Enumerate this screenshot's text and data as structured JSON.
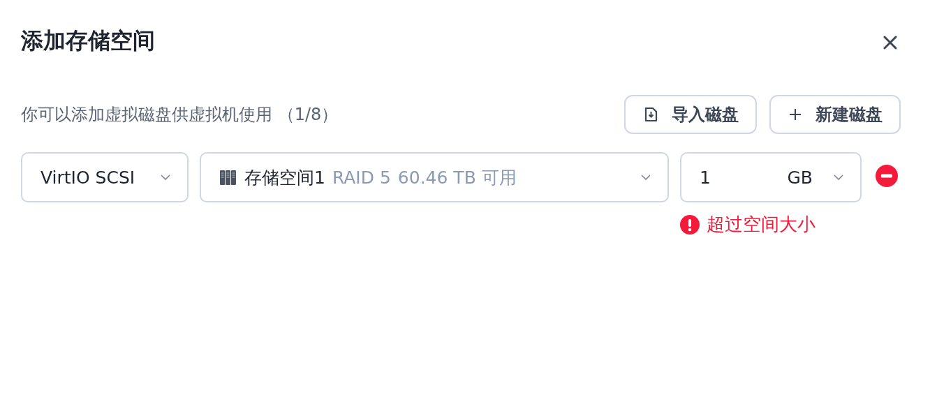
{
  "dialog": {
    "title": "添加存储空间",
    "description": "你可以添加虚拟磁盘供虚拟机使用 （1/8）",
    "buttons": [
      {
        "label": "导入磁盘",
        "kind": "import"
      },
      {
        "label": "新建磁盘",
        "kind": "new"
      }
    ],
    "disks": [
      {
        "bus": "VirtIO SCSI",
        "pool_name": "存储空间1",
        "raid": "RAID 5",
        "free": "60.46 TB 可用",
        "size": "1",
        "unit": "GB",
        "error": "超过空间大小"
      }
    ]
  }
}
